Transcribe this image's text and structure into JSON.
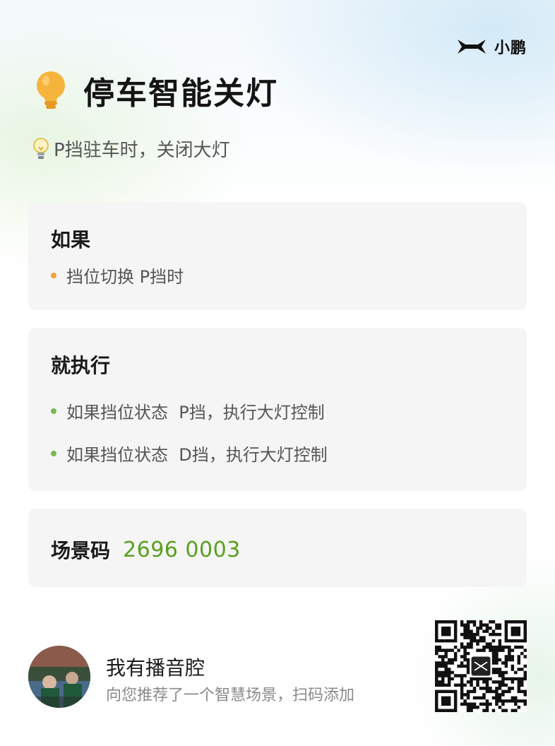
{
  "brand": {
    "name": "小鹏"
  },
  "header": {
    "title": "停车智能关灯",
    "icon": "lightbulb-icon"
  },
  "subtitle": {
    "icon": "small-lightbulb-icon",
    "text": "P挡驻车时，关闭大灯"
  },
  "condition": {
    "title": "如果",
    "items": [
      {
        "text": "挡位切换 P挡时"
      }
    ]
  },
  "action": {
    "title": "就执行",
    "items": [
      {
        "text": "如果挡位状态  P挡，执行大灯控制"
      },
      {
        "text": "如果挡位状态  D挡，执行大灯控制"
      }
    ]
  },
  "scene_code": {
    "label": "场景码",
    "value": "2696 0003"
  },
  "share": {
    "user_name": "我有播音腔",
    "description": "向您推荐了一个智慧场景，扫码添加"
  },
  "colors": {
    "condition_dot": "#f0a038",
    "action_dot": "#7ab850",
    "scene_code": "#5aa01f",
    "bulb": "#f7b43c"
  }
}
